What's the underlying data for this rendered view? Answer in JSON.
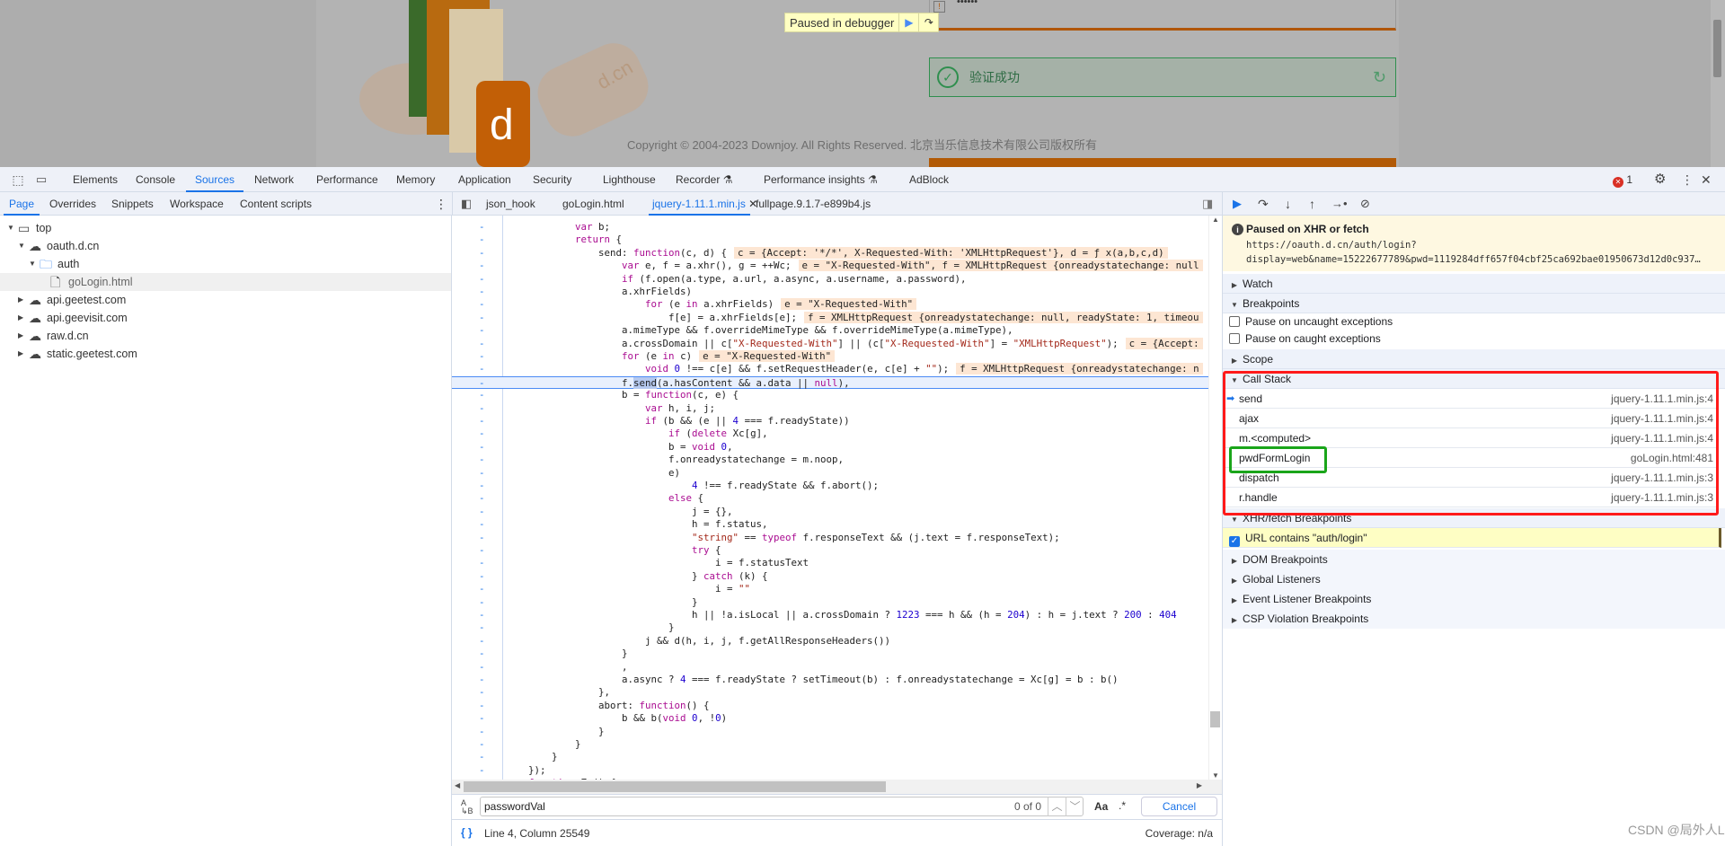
{
  "page": {
    "paused_badge": "Paused in debugger",
    "success_text": "验证成功",
    "copyright": "Copyright © 2004-2023 Downjoy. All Rights Reserved. 北京当乐信息技术有限公司版权所有",
    "password_mask": "••••••"
  },
  "devtools": {
    "tabs": [
      "Elements",
      "Console",
      "Sources",
      "Network",
      "Performance",
      "Memory",
      "Application",
      "Security",
      "Lighthouse",
      "Recorder",
      "Performance insights",
      "AdBlock"
    ],
    "active_tab": "Sources",
    "error_count": "1"
  },
  "navigator": {
    "tabs": [
      "Page",
      "Overrides",
      "Snippets",
      "Workspace",
      "Content scripts"
    ],
    "tree": [
      {
        "label": "top",
        "icon": "frame-icon",
        "depth": 0,
        "open": true
      },
      {
        "label": "oauth.d.cn",
        "icon": "cloud-icon",
        "depth": 1,
        "open": true
      },
      {
        "label": "auth",
        "icon": "folder-icon",
        "depth": 2,
        "open": true
      },
      {
        "label": "goLogin.html",
        "icon": "file-icon",
        "depth": 3,
        "selected": true
      },
      {
        "label": "api.geetest.com",
        "icon": "cloud-icon",
        "depth": 1,
        "open": false
      },
      {
        "label": "api.geevisit.com",
        "icon": "cloud-icon",
        "depth": 1,
        "open": false
      },
      {
        "label": "raw.d.cn",
        "icon": "cloud-icon",
        "depth": 1,
        "open": false
      },
      {
        "label": "static.geetest.com",
        "icon": "cloud-icon",
        "depth": 1,
        "open": false
      }
    ]
  },
  "editor": {
    "tabs": [
      "json_hook",
      "goLogin.html",
      "jquery-1.11.1.min.js",
      "fullpage.9.1.7-e899b4.js"
    ],
    "active_tab": "jquery-1.11.1.min.js",
    "gutter_mark": "-",
    "lines": [
      {
        "i": 12,
        "t": "var b;"
      },
      {
        "i": 12,
        "t": "return {"
      },
      {
        "i": 16,
        "t": "send: function(c, d) {",
        "v": "c = {Accept: '*/*', X-Requested-With: 'XMLHttpRequest'}, d = ƒ x(a,b,c,d)"
      },
      {
        "i": 20,
        "t": "var e, f = a.xhr(), g = ++Wc;",
        "v": "e = \"X-Requested-With\", f = XMLHttpRequest {onreadystatechange: null"
      },
      {
        "i": 20,
        "t": "if (f.open(a.type, a.url, a.async, a.username, a.password),"
      },
      {
        "i": 20,
        "t": "a.xhrFields)"
      },
      {
        "i": 24,
        "t": "for (e in a.xhrFields)",
        "v": "e = \"X-Requested-With\""
      },
      {
        "i": 28,
        "t": "f[e] = a.xhrFields[e];",
        "v": "f = XMLHttpRequest {onreadystatechange: null, readyState: 1, timeou"
      },
      {
        "i": 20,
        "t": "a.mimeType && f.overrideMimeType && f.overrideMimeType(a.mimeType),"
      },
      {
        "i": 20,
        "t": "a.crossDomain || c[\"X-Requested-With\"] || (c[\"X-Requested-With\"] = \"XMLHttpRequest\");",
        "v": "c = {Accept:"
      },
      {
        "i": 20,
        "t": "for (e in c)",
        "v": "e = \"X-Requested-With\""
      },
      {
        "i": 24,
        "t": "void 0 !== c[e] && f.setRequestHeader(e, c[e] + \"\");",
        "v": "f = XMLHttpRequest {onreadystatechange: n"
      },
      {
        "i": 20,
        "t": "f.send(a.hasContent && a.data || null),",
        "current": true
      },
      {
        "i": 20,
        "t": "b = function(c, e) {"
      },
      {
        "i": 24,
        "t": "var h, i, j;"
      },
      {
        "i": 24,
        "t": "if (b && (e || 4 === f.readyState))"
      },
      {
        "i": 28,
        "t": "if (delete Xc[g],"
      },
      {
        "i": 28,
        "t": "b = void 0,"
      },
      {
        "i": 28,
        "t": "f.onreadystatechange = m.noop,"
      },
      {
        "i": 28,
        "t": "e)"
      },
      {
        "i": 32,
        "t": "4 !== f.readyState && f.abort();"
      },
      {
        "i": 28,
        "t": "else {"
      },
      {
        "i": 32,
        "t": "j = {},"
      },
      {
        "i": 32,
        "t": "h = f.status,"
      },
      {
        "i": 32,
        "t": "\"string\" == typeof f.responseText && (j.text = f.responseText);"
      },
      {
        "i": 32,
        "t": "try {"
      },
      {
        "i": 36,
        "t": "i = f.statusText"
      },
      {
        "i": 32,
        "t": "} catch (k) {"
      },
      {
        "i": 36,
        "t": "i = \"\""
      },
      {
        "i": 32,
        "t": "}"
      },
      {
        "i": 32,
        "t": "h || !a.isLocal || a.crossDomain ? 1223 === h && (h = 204) : h = j.text ? 200 : 404"
      },
      {
        "i": 28,
        "t": "}"
      },
      {
        "i": 24,
        "t": "j && d(h, i, j, f.getAllResponseHeaders())"
      },
      {
        "i": 20,
        "t": "}"
      },
      {
        "i": 20,
        "t": ","
      },
      {
        "i": 20,
        "t": "a.async ? 4 === f.readyState ? setTimeout(b) : f.onreadystatechange = Xc[g] = b : b()"
      },
      {
        "i": 16,
        "t": "},"
      },
      {
        "i": 16,
        "t": "abort: function() {"
      },
      {
        "i": 20,
        "t": "b && b(void 0, !0)"
      },
      {
        "i": 16,
        "t": "}"
      },
      {
        "i": 12,
        "t": "}"
      },
      {
        "i": 8,
        "t": "}"
      },
      {
        "i": 4,
        "t": "});"
      },
      {
        "i": 4,
        "t": "function Zc() {"
      }
    ]
  },
  "search": {
    "value": "passwordVal",
    "count": "0 of 0",
    "match_case": "Aa",
    "regex": ".*",
    "cancel": "Cancel"
  },
  "status": {
    "position": "Line 4, Column 25549",
    "coverage": "Coverage: n/a"
  },
  "debugger": {
    "paused_title": "Paused on XHR or fetch",
    "paused_url_1": "https://oauth.d.cn/auth/login?",
    "paused_url_2": "display=web&name=15222677789&pwd=1119284dff657f04cbf25ca692bae01950673d12d0c937…",
    "watch": "Watch",
    "breakpoints": "Breakpoints",
    "pause_uncaught": "Pause on uncaught exceptions",
    "pause_caught": "Pause on caught exceptions",
    "scope": "Scope",
    "call_stack": "Call Stack",
    "frames": [
      {
        "fn": "send",
        "loc": "jquery-1.11.1.min.js:4",
        "current": true
      },
      {
        "fn": "ajax",
        "loc": "jquery-1.11.1.min.js:4"
      },
      {
        "fn": "m.<computed>",
        "loc": "jquery-1.11.1.min.js:4"
      },
      {
        "fn": "pwdFormLogin",
        "loc": "goLogin.html:481"
      },
      {
        "fn": "dispatch",
        "loc": "jquery-1.11.1.min.js:3"
      },
      {
        "fn": "r.handle",
        "loc": "jquery-1.11.1.min.js:3"
      }
    ],
    "xhr_breakpoints": "XHR/fetch Breakpoints",
    "xhr_rule": "URL contains \"auth/login\"",
    "dom_breakpoints": "DOM Breakpoints",
    "global_listeners": "Global Listeners",
    "event_listener_breakpoints": "Event Listener Breakpoints",
    "csp_breakpoints": "CSP Violation Breakpoints"
  },
  "annotations": {
    "red_box_color": "#ff1a1a",
    "green_box_color": "#1aa51a"
  },
  "watermark": "CSDN @局外人LZ",
  "colors": {
    "accent": "#1a73e8",
    "keyword": "#aa0d91",
    "string": "#a3281a",
    "number": "#1c00cf"
  }
}
